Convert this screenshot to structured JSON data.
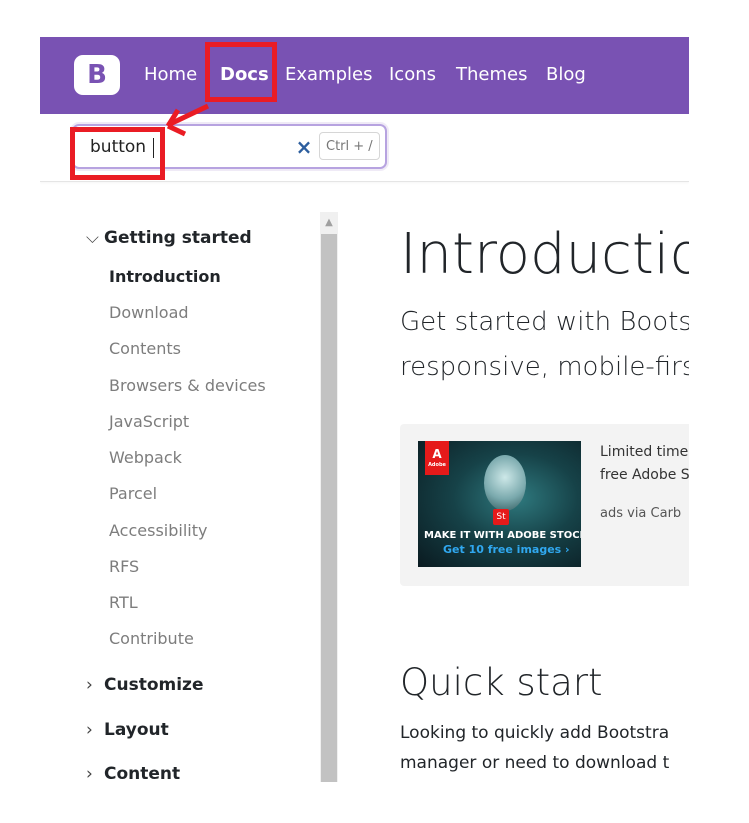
{
  "navbar": {
    "brand_letter": "B",
    "links": [
      "Home",
      "Docs",
      "Examples",
      "Icons",
      "Themes",
      "Blog"
    ],
    "active_link": "Docs",
    "background_color": "#7952b3"
  },
  "search": {
    "value": "button",
    "clear_icon": "×",
    "shortcut": "Ctrl + /"
  },
  "sidebar": {
    "groups": [
      {
        "label": "Getting started",
        "expanded": true,
        "items": [
          "Introduction",
          "Download",
          "Contents",
          "Browsers & devices",
          "JavaScript",
          "Webpack",
          "Parcel",
          "Accessibility",
          "RFS",
          "RTL",
          "Contribute"
        ],
        "active_item": "Introduction"
      },
      {
        "label": "Customize",
        "expanded": false
      },
      {
        "label": "Layout",
        "expanded": false
      },
      {
        "label": "Content",
        "expanded": false
      }
    ]
  },
  "main": {
    "title": "Introductio",
    "lead_lines": [
      "Get started with Boots",
      "responsive, mobile-firs"
    ],
    "ad": {
      "logo_text": "A",
      "logo_sub": "Adobe",
      "badge": "St",
      "headline": "MAKE IT WITH ADOBE STOCK.",
      "cta": "Get 10 free images ›",
      "text_lines": [
        "Limited time",
        "free Adobe S"
      ],
      "credit": "ads via Carb"
    },
    "section_title": "Quick start",
    "paragraph_lines": [
      "Looking to quickly add Bootstra",
      "manager or need to download t"
    ]
  },
  "annotation_color": "#ea1c24"
}
